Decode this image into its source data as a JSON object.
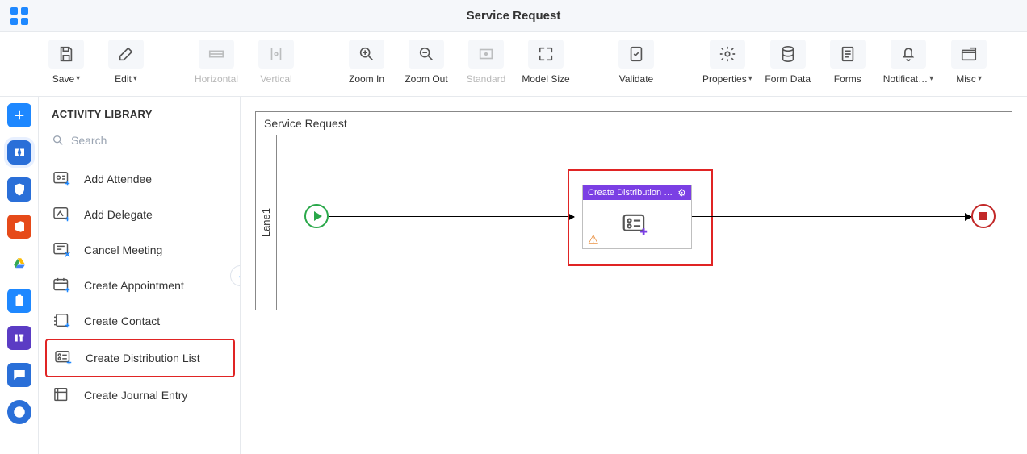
{
  "header": {
    "title": "Service Request"
  },
  "toolbar": {
    "save": "Save",
    "edit": "Edit",
    "horizontal": "Horizontal",
    "vertical": "Vertical",
    "zoom_in": "Zoom In",
    "zoom_out": "Zoom Out",
    "standard": "Standard",
    "model_size": "Model Size",
    "validate": "Validate",
    "properties": "Properties",
    "form_data": "Form Data",
    "forms": "Forms",
    "notifications": "Notificat…",
    "misc": "Misc"
  },
  "panel": {
    "heading": "ACTIVITY LIBRARY",
    "search_placeholder": "Search",
    "items": [
      {
        "label": "Add Attendee"
      },
      {
        "label": "Add Delegate"
      },
      {
        "label": "Cancel Meeting"
      },
      {
        "label": "Create Appointment"
      },
      {
        "label": "Create Contact"
      },
      {
        "label": "Create Distribution List"
      },
      {
        "label": "Create Journal Entry"
      }
    ]
  },
  "process": {
    "pool_name": "Service Request",
    "lane_name": "Lane1",
    "task_label": "Create Distribution …"
  }
}
